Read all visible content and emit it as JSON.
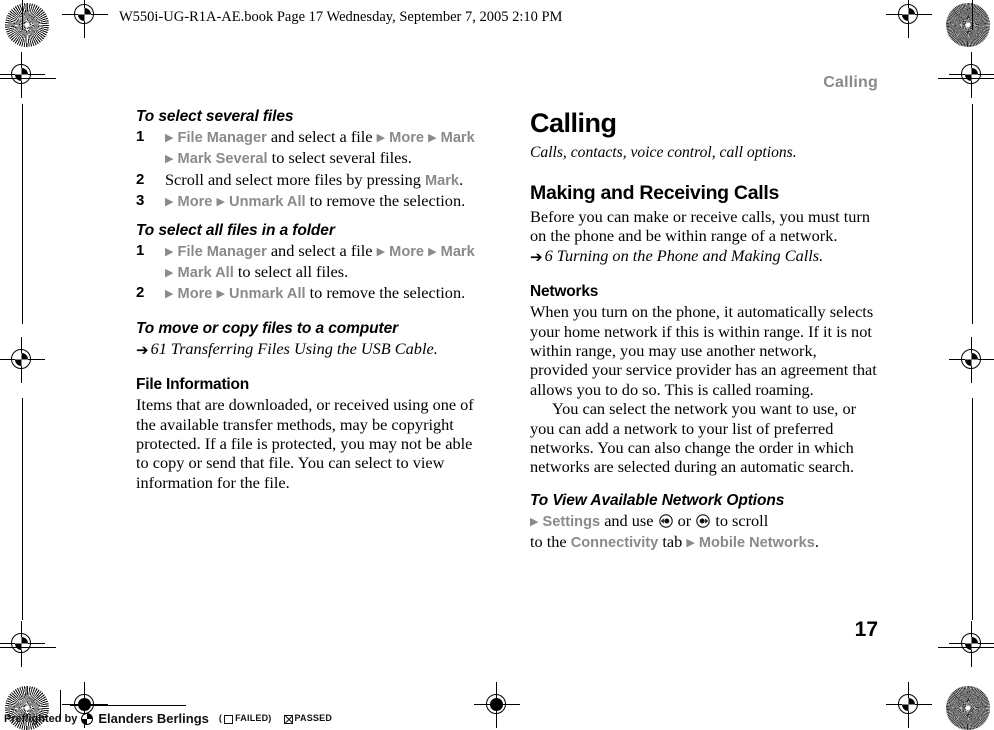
{
  "print_marks": {
    "book_header": "W550i-UG-R1A-AE.book  Page 17  Wednesday, September 7, 2005  2:10 PM",
    "preflight": {
      "prefix": "Preflighted by",
      "brand": "Elanders Berlings",
      "open_paren": "(",
      "failed_label": "FAILED",
      "close_paren": ")",
      "passed_label": "PASSED"
    }
  },
  "page": {
    "running_head": "Calling",
    "page_number": "17"
  },
  "left_column": {
    "proc1": {
      "heading": "To select several files",
      "steps": [
        {
          "num": "1",
          "line1": [
            {
              "t": "arrow"
            },
            {
              "t": "ui",
              "v": "File Manager"
            },
            {
              "t": "text",
              "v": " and select a file "
            },
            {
              "t": "arrow"
            },
            {
              "t": "ui",
              "v": "More"
            },
            {
              "t": "text",
              "v": " "
            },
            {
              "t": "arrow"
            },
            {
              "t": "ui",
              "v": "Mark"
            }
          ],
          "line2": [
            {
              "t": "arrow"
            },
            {
              "t": "ui",
              "v": "Mark Several"
            },
            {
              "t": "text",
              "v": " to select several files."
            }
          ]
        },
        {
          "num": "2",
          "line1": [
            {
              "t": "text",
              "v": "Scroll and select more files by pressing "
            },
            {
              "t": "ui",
              "v": "Mark"
            },
            {
              "t": "text",
              "v": "."
            }
          ]
        },
        {
          "num": "3",
          "line1": [
            {
              "t": "arrow"
            },
            {
              "t": "ui",
              "v": "More"
            },
            {
              "t": "text",
              "v": " "
            },
            {
              "t": "arrow"
            },
            {
              "t": "ui",
              "v": "Unmark All"
            },
            {
              "t": "text",
              "v": " to remove the selection."
            }
          ]
        }
      ]
    },
    "proc2": {
      "heading": "To select all files in a folder",
      "steps": [
        {
          "num": "1",
          "line1": [
            {
              "t": "arrow"
            },
            {
              "t": "ui",
              "v": "File Manager"
            },
            {
              "t": "text",
              "v": " and select a file "
            },
            {
              "t": "arrow"
            },
            {
              "t": "ui",
              "v": "More"
            },
            {
              "t": "text",
              "v": " "
            },
            {
              "t": "arrow"
            },
            {
              "t": "ui",
              "v": "Mark"
            }
          ],
          "line2": [
            {
              "t": "arrow"
            },
            {
              "t": "ui",
              "v": "Mark All"
            },
            {
              "t": "text",
              "v": " to select all files."
            }
          ]
        },
        {
          "num": "2",
          "line1": [
            {
              "t": "arrow"
            },
            {
              "t": "ui",
              "v": "More"
            },
            {
              "t": "text",
              "v": " "
            },
            {
              "t": "arrow"
            },
            {
              "t": "ui",
              "v": "Unmark All"
            },
            {
              "t": "text",
              "v": " to remove the selection."
            }
          ]
        }
      ]
    },
    "proc3": {
      "heading": "To move or copy files to a computer",
      "xref": "61 Transferring Files Using the USB Cable."
    },
    "file_info": {
      "heading": "File Information",
      "body": "Items that are downloaded, or received using one of the available transfer methods, may be copyright protected. If a file is protected, you may not be able to copy or send that file. You can select to view information for the file."
    }
  },
  "right_column": {
    "chapter_title": "Calling",
    "chapter_lead": "Calls, contacts, voice control, call options.",
    "section1": {
      "heading": "Making and Receiving Calls",
      "body": "Before you can make or receive calls, you must turn on the phone and be within range of a network.",
      "xref": "6 Turning on the Phone and Making Calls."
    },
    "networks": {
      "heading": "Networks",
      "para1": "When you turn on the phone, it automatically selects your home network if this is within range. If it is not within range, you may use another network, provided your service provider has an agreement that allows you to do so. This is called roaming.",
      "para2": "You can select the network you want to use, or you can add a network to your list of preferred networks. You can also change the order in which networks are selected during an automatic search."
    },
    "proc4": {
      "heading": "To View Available Network Options",
      "line1": [
        {
          "t": "arrow"
        },
        {
          "t": "ui",
          "v": "Settings"
        },
        {
          "t": "text",
          "v": " and use "
        },
        {
          "t": "navkey",
          "v": "nav-left"
        },
        {
          "t": "text",
          "v": " or "
        },
        {
          "t": "navkey",
          "v": "nav-right"
        },
        {
          "t": "text",
          "v": " to scroll"
        }
      ],
      "line2": [
        {
          "t": "text",
          "v": "to the "
        },
        {
          "t": "ui",
          "v": "Connectivity"
        },
        {
          "t": "text",
          "v": " tab "
        },
        {
          "t": "arrow"
        },
        {
          "t": "ui",
          "v": "Mobile Networks"
        },
        {
          "t": "text",
          "v": "."
        }
      ]
    }
  },
  "colors": {
    "ui_label_gray": "#8a8a8a",
    "running_head_gray": "#8a8a8a",
    "text_black": "#000000"
  }
}
